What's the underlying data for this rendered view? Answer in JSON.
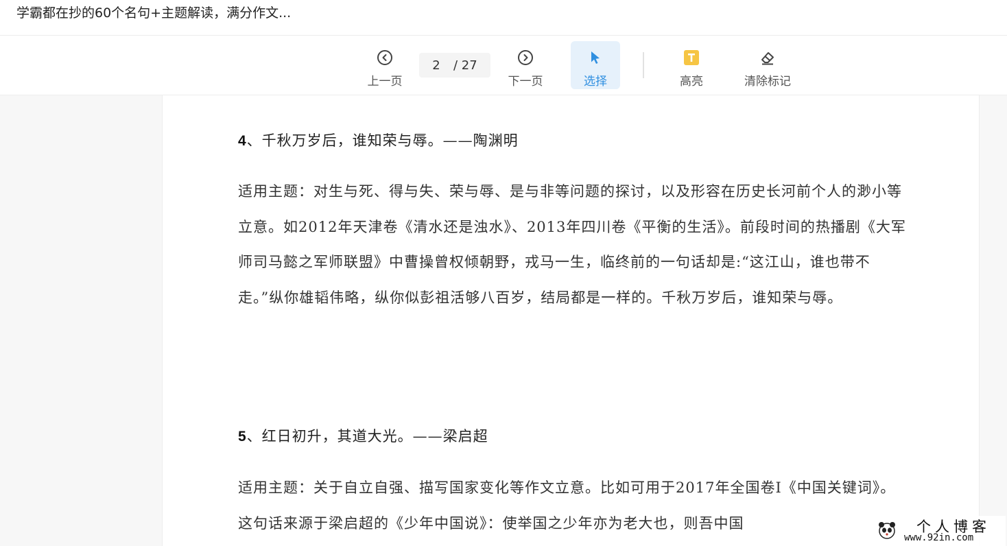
{
  "header": {
    "doc_title": "学霸都在抄的60个名句+主题解读，满分作文..."
  },
  "toolbar": {
    "prev_label": "上一页",
    "next_label": "下一页",
    "select_label": "选择",
    "highlight_label": "高亮",
    "clear_label": "清除标记",
    "current_page": "2",
    "total_pages": "/ 27",
    "accent_color": "#2f8fe0",
    "highlight_color": "#f6c544"
  },
  "document": {
    "sections": [
      {
        "number": "4",
        "quote": "、千秋万岁后，谁知荣与辱。——陶渊明",
        "body": "适用主题：对生与死、得与失、荣与辱、是与非等问题的探讨，以及形容在历史长河前个人的渺小等立意。如2012年天津卷《清水还是浊水》、2013年四川卷《平衡的生活》。前段时间的热播剧《大军师司马懿之军师联盟》中曹操曾权倾朝野，戎马一生，临终前的一句话却是:“这江山，谁也带不走。”纵你雄韬伟略，纵你似彭祖活够八百岁，结局都是一样的。千秋万岁后，谁知荣与辱。"
      },
      {
        "number": "5",
        "quote": "、红日初升，其道大光。——梁启超",
        "body": "适用主题：关于自立自强、描写国家变化等作文立意。比如可用于2017年全国卷I《中国关键词》。这句话来源于梁启超的《少年中国说》：使举国之少年亦为老大也，则吾中国"
      }
    ]
  },
  "watermark": {
    "title": "个人博客",
    "url": "www.92in.com"
  }
}
